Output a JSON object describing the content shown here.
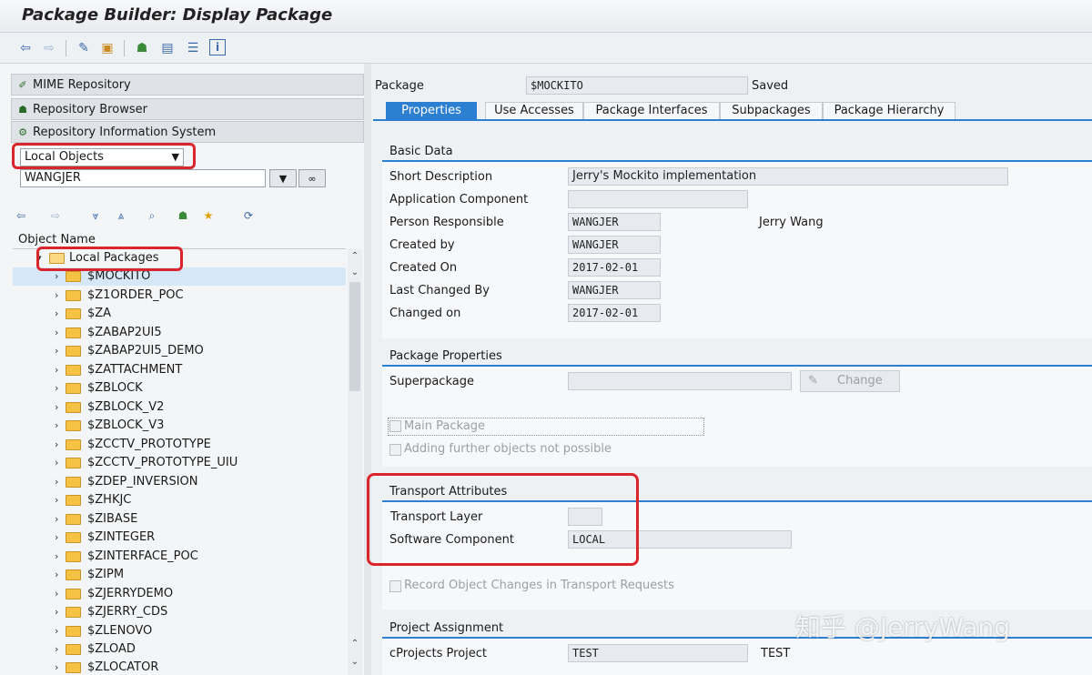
{
  "window": {
    "title": "Package Builder: Display Package"
  },
  "toolbar": {
    "icons": [
      "back-arrow-icon",
      "forward-arrow-icon",
      "edit-toggle-icon",
      "other-object-icon",
      "hierarchy-icon",
      "display-object-list-icon",
      "where-used-icon",
      "info-icon"
    ]
  },
  "left_panel": {
    "nav": [
      {
        "label": "MIME Repository",
        "icon": "mime-icon"
      },
      {
        "label": "Repository Browser",
        "icon": "tree-icon"
      },
      {
        "label": "Repository Information System",
        "icon": "info-system-icon"
      }
    ],
    "object_type": "Local Objects",
    "user": "WANGJER",
    "object_list_header": "Object Name",
    "root": "Local Packages",
    "packages": [
      "$MOCKITO",
      "$Z1ORDER_POC",
      "$ZA",
      "$ZABAP2UI5",
      "$ZABAP2UI5_DEMO",
      "$ZATTACHMENT",
      "$ZBLOCK",
      "$ZBLOCK_V2",
      "$ZBLOCK_V3",
      "$ZCCTV_PROTOTYPE",
      "$ZCCTV_PROTOTYPE_UIU",
      "$ZDEP_INVERSION",
      "$ZHKJC",
      "$ZIBASE",
      "$ZINTEGER",
      "$ZINTERFACE_POC",
      "$ZIPM",
      "$ZJERRYDEMO",
      "$ZJERRY_CDS",
      "$ZLENOVO",
      "$ZLOAD",
      "$ZLOCATOR"
    ]
  },
  "right_panel": {
    "package_label": "Package",
    "package_value": "$MOCKITO",
    "status": "Saved",
    "tabs": [
      "Properties",
      "Use Accesses",
      "Package Interfaces",
      "Subpackages",
      "Package Hierarchy"
    ],
    "active_tab": "Properties",
    "basic_data": {
      "title": "Basic Data",
      "short_desc_label": "Short Description",
      "short_desc": "Jerry's Mockito implementation",
      "app_comp_label": "Application Component",
      "app_comp": "",
      "person_label": "Person Responsible",
      "person": "WANGJER",
      "person_name": "Jerry Wang",
      "created_by_label": "Created by",
      "created_by": "WANGJER",
      "created_on_label": "Created On",
      "created_on": "2017-02-01",
      "last_changed_by_label": "Last Changed By",
      "last_changed_by": "WANGJER",
      "changed_on_label": "Changed on",
      "changed_on": "2017-02-01"
    },
    "package_properties": {
      "title": "Package Properties",
      "superpackage_label": "Superpackage",
      "superpackage": "",
      "change_button": "Change",
      "main_package": "Main Package",
      "adding_not_possible": "Adding further objects not possible"
    },
    "transport": {
      "title": "Transport Attributes",
      "layer_label": "Transport Layer",
      "layer": "",
      "software_comp_label": "Software Component",
      "software_comp": "LOCAL",
      "record_changes": "Record Object Changes in Transport Requests"
    },
    "project": {
      "title": "Project Assignment",
      "cprojects_label": "cProjects Project",
      "cprojects": "TEST",
      "cprojects_text": "TEST"
    }
  },
  "watermark": "知乎 @JerryWang"
}
